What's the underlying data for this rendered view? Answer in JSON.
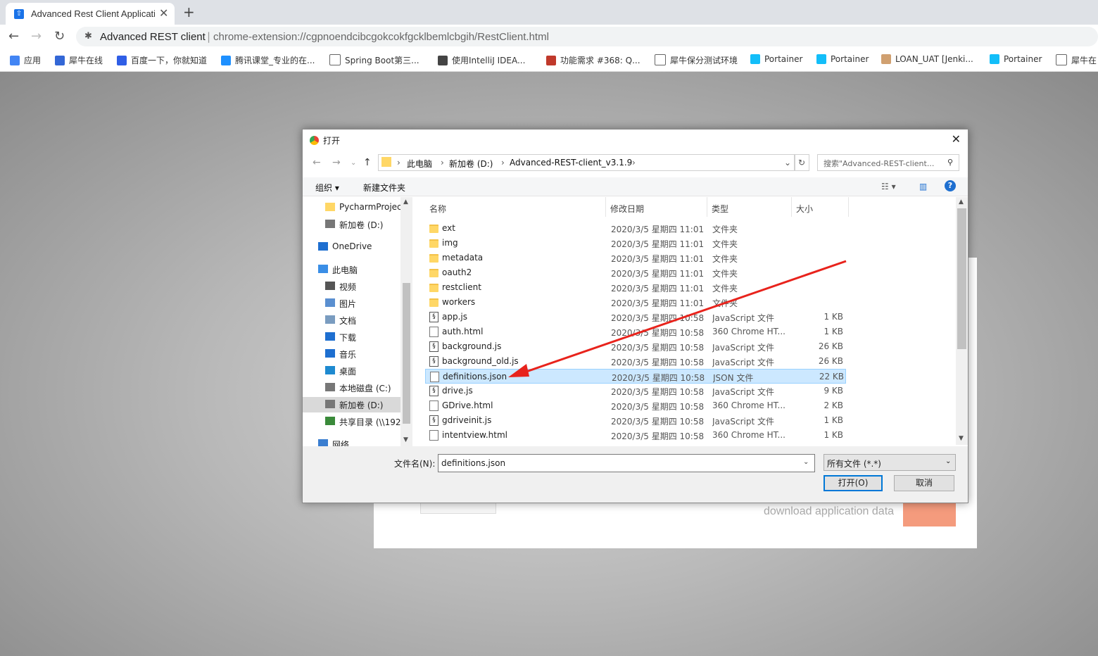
{
  "browser": {
    "tab_title": "Advanced Rest Client Applicati",
    "tab_close": "✕",
    "new_tab": "+",
    "site_name": "Advanced REST client",
    "url": "chrome-extension://cgpnoendcibcgokcokfgcklbemlcbgih/RestClient.html",
    "bookmarks": [
      {
        "label": "应用",
        "icon": "apps-grid-icon",
        "color": "#4285f4"
      },
      {
        "label": "犀牛在线",
        "icon": "bookmark-logo-icon",
        "color": "#3367d6"
      },
      {
        "label": "百度一下，你就知道",
        "icon": "baidu-paw-icon",
        "color": "#2f5ee6"
      },
      {
        "label": "腾讯课堂_专业的在...",
        "icon": "shield-icon",
        "color": "#1e90ff"
      },
      {
        "label": "Spring Boot第三...",
        "icon": "page-icon",
        "color": "#ffffff"
      },
      {
        "label": "使用IntelliJ IDEA...",
        "icon": "feather-icon",
        "color": "#444444"
      },
      {
        "label": "功能需求 #368: Q...",
        "icon": "redmine-icon",
        "color": "#c0392b"
      },
      {
        "label": "犀牛保分测试环境",
        "icon": "page-icon",
        "color": "#ffffff"
      },
      {
        "label": "Portainer",
        "icon": "portainer-icon",
        "color": "#13bef9"
      },
      {
        "label": "Portainer",
        "icon": "portainer-icon",
        "color": "#13bef9"
      },
      {
        "label": "LOAN_UAT [Jenki...",
        "icon": "jenkins-icon",
        "color": "#d0a070"
      },
      {
        "label": "Portainer",
        "icon": "portainer-icon",
        "color": "#13bef9"
      },
      {
        "label": "犀牛在",
        "icon": "page-icon",
        "color": "#ffffff"
      }
    ]
  },
  "background_app": {
    "text": "download application data",
    "flag_color": "#f49b7d"
  },
  "dialog": {
    "title": "打开",
    "close": "✕",
    "breadcrumb": [
      "此电脑",
      "新加卷 (D:)",
      "Advanced-REST-client_v3.1.9"
    ],
    "search_placeholder": "搜索\"Advanced-REST-client...",
    "organize": "组织 ▾",
    "new_folder": "新建文件夹",
    "nav": [
      {
        "label": "PycharmProjec",
        "icon": "folder-icon"
      },
      {
        "label": "新加卷 (D:)",
        "icon": "drive-icon"
      },
      {
        "label": "OneDrive",
        "icon": "cloud-icon"
      },
      {
        "label": "此电脑",
        "icon": "computer-icon"
      },
      {
        "label": "视频",
        "icon": "video-icon"
      },
      {
        "label": "图片",
        "icon": "picture-icon"
      },
      {
        "label": "文档",
        "icon": "document-icon"
      },
      {
        "label": "下载",
        "icon": "download-icon"
      },
      {
        "label": "音乐",
        "icon": "music-icon"
      },
      {
        "label": "桌面",
        "icon": "desktop-icon"
      },
      {
        "label": "本地磁盘 (C:)",
        "icon": "drive-icon"
      },
      {
        "label": "新加卷 (D:)",
        "icon": "drive-icon",
        "selected": true
      },
      {
        "label": "共享目录 (\\\\192",
        "icon": "network-drive-icon"
      },
      {
        "label": "网络",
        "icon": "network-icon"
      }
    ],
    "columns": [
      "名称",
      "修改日期",
      "类型",
      "大小"
    ],
    "files": [
      {
        "name": "ext",
        "date": "2020/3/5 星期四 11:01",
        "type": "文件夹",
        "size": "",
        "kind": "folder"
      },
      {
        "name": "img",
        "date": "2020/3/5 星期四 11:01",
        "type": "文件夹",
        "size": "",
        "kind": "folder"
      },
      {
        "name": "metadata",
        "date": "2020/3/5 星期四 11:01",
        "type": "文件夹",
        "size": "",
        "kind": "folder"
      },
      {
        "name": "oauth2",
        "date": "2020/3/5 星期四 11:01",
        "type": "文件夹",
        "size": "",
        "kind": "folder"
      },
      {
        "name": "restclient",
        "date": "2020/3/5 星期四 11:01",
        "type": "文件夹",
        "size": "",
        "kind": "folder"
      },
      {
        "name": "workers",
        "date": "2020/3/5 星期四 11:01",
        "type": "文件夹",
        "size": "",
        "kind": "folder"
      },
      {
        "name": "app.js",
        "date": "2020/3/5 星期四 10:58",
        "type": "JavaScript 文件",
        "size": "1 KB",
        "kind": "js"
      },
      {
        "name": "auth.html",
        "date": "2020/3/5 星期四 10:58",
        "type": "360 Chrome HT...",
        "size": "1 KB",
        "kind": "doc"
      },
      {
        "name": "background.js",
        "date": "2020/3/5 星期四 10:58",
        "type": "JavaScript 文件",
        "size": "26 KB",
        "kind": "js"
      },
      {
        "name": "background_old.js",
        "date": "2020/3/5 星期四 10:58",
        "type": "JavaScript 文件",
        "size": "26 KB",
        "kind": "js"
      },
      {
        "name": "definitions.json",
        "date": "2020/3/5 星期四 10:58",
        "type": "JSON 文件",
        "size": "22 KB",
        "kind": "doc",
        "selected": true
      },
      {
        "name": "drive.js",
        "date": "2020/3/5 星期四 10:58",
        "type": "JavaScript 文件",
        "size": "9 KB",
        "kind": "js"
      },
      {
        "name": "GDrive.html",
        "date": "2020/3/5 星期四 10:58",
        "type": "360 Chrome HT...",
        "size": "2 KB",
        "kind": "doc"
      },
      {
        "name": "gdriveinit.js",
        "date": "2020/3/5 星期四 10:58",
        "type": "JavaScript 文件",
        "size": "1 KB",
        "kind": "js"
      },
      {
        "name": "intentview.html",
        "date": "2020/3/5 星期四 10:58",
        "type": "360 Chrome HT...",
        "size": "1 KB",
        "kind": "doc"
      }
    ],
    "filename_label": "文件名(N):",
    "filename_value": "definitions.json",
    "filetype_value": "所有文件 (*.*)",
    "open_button": "打开(O)",
    "cancel_button": "取消"
  },
  "annotation": {
    "color": "#e8231c",
    "shape": "arrow",
    "target": "definitions.json"
  }
}
